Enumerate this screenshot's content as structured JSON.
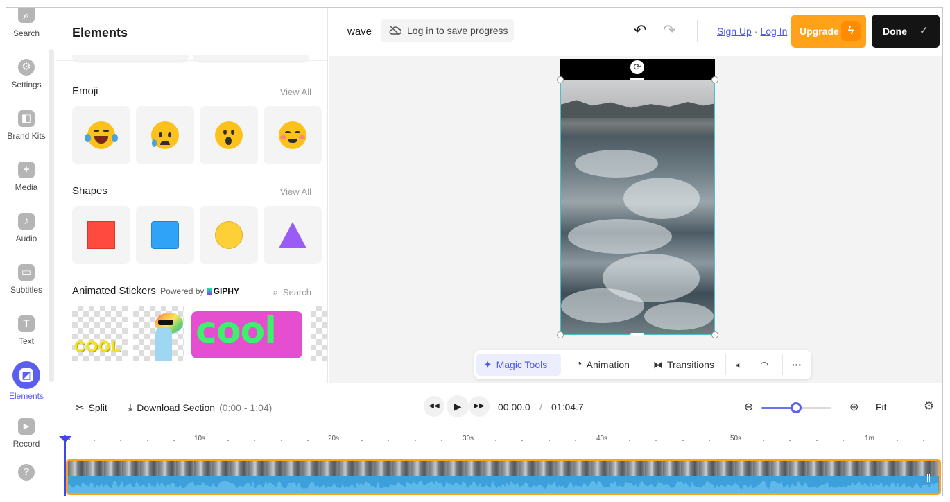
{
  "rail": {
    "items": [
      {
        "label": "Search",
        "glyph": "⌕",
        "icon": "search-icon"
      },
      {
        "label": "Settings",
        "glyph": "⚙",
        "icon": "settings-icon"
      },
      {
        "label": "Brand Kits",
        "glyph": "◧",
        "icon": "brand-kits-icon"
      },
      {
        "label": "Media",
        "glyph": "+",
        "icon": "media-icon"
      },
      {
        "label": "Audio",
        "glyph": "♪",
        "icon": "audio-icon"
      },
      {
        "label": "Subtitles",
        "glyph": "▭",
        "icon": "subtitles-icon"
      },
      {
        "label": "Text",
        "glyph": "T",
        "icon": "text-icon"
      },
      {
        "label": "Elements",
        "glyph": "◩",
        "icon": "elements-icon"
      },
      {
        "label": "Record",
        "glyph": "▶",
        "icon": "record-icon"
      },
      {
        "label": "",
        "glyph": "?",
        "icon": "help-icon"
      }
    ]
  },
  "panel": {
    "title": "Elements",
    "emoji": {
      "title": "Emoji",
      "view_all": "View All"
    },
    "shapes": {
      "title": "Shapes",
      "view_all": "View All"
    },
    "stickers": {
      "title": "Animated Stickers",
      "powered_by": "Powered by",
      "brand": "GIPHY",
      "search_placeholder": "Search"
    },
    "sticker_texts": [
      "COOL",
      "cool"
    ]
  },
  "topbar": {
    "project_name": "wave",
    "login_save": "Log in to save progress",
    "sign_up": "Sign Up",
    "separator": "·",
    "log_in": "Log In",
    "upgrade": "Upgrade",
    "done": "Done"
  },
  "canvas_toolbar": {
    "magic_tools": "Magic Tools",
    "animation": "Animation",
    "transitions": "Transitions"
  },
  "timeline": {
    "split": "Split",
    "download_section": "Download Section",
    "download_range": "(0:00 - 1:04)",
    "current_time": "00:00.0",
    "time_sep": "/",
    "total_time": "01:04.7",
    "fit": "Fit",
    "zoom_level": 0.5,
    "ruler_labels": [
      "0s",
      "10s",
      "20s",
      "30s",
      "40s",
      "50s",
      "1m"
    ]
  },
  "colors": {
    "accent": "#5b60ec",
    "upgrade": "#ffa21a",
    "done": "#141414",
    "track_border": "#ffa21a",
    "waveform": "#3da0da"
  }
}
